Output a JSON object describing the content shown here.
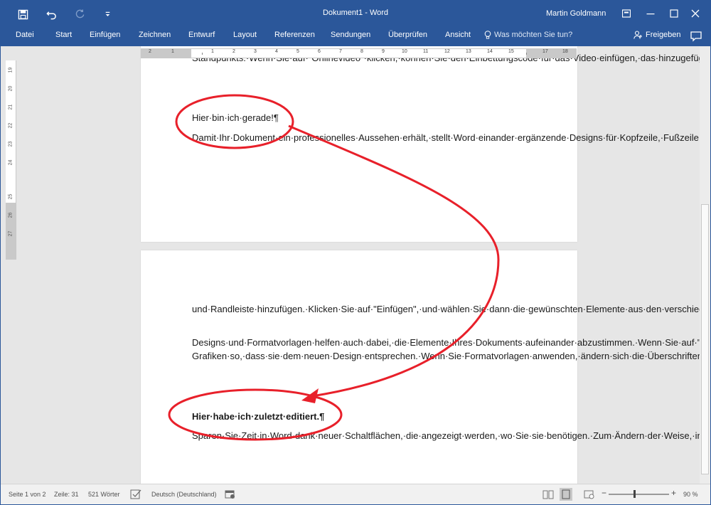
{
  "titlebar": {
    "doc_title": "Dokument1  -  Word",
    "user_name": "Martin Goldmann"
  },
  "ribbon": {
    "tabs": [
      "Datei",
      "Start",
      "Einfügen",
      "Zeichnen",
      "Entwurf",
      "Layout",
      "Referenzen",
      "Sendungen",
      "Überprüfen",
      "Ansicht"
    ],
    "tell_me": "Was möchten Sie tun?",
    "share": "Freigeben"
  },
  "ruler": {
    "horizontal_ticks": [
      "2",
      "1",
      "1",
      "2",
      "3",
      "4",
      "5",
      "6",
      "7",
      "8",
      "9",
      "10",
      "11",
      "12",
      "13",
      "14",
      "15",
      "17",
      "18"
    ],
    "vertical_ticks": [
      "19",
      "20",
      "21",
      "22",
      "23",
      "24",
      "25",
      "26",
      "27"
    ]
  },
  "page1": {
    "p1": "Standpunkts.·Wenn·Sie·auf·\"Onlinevideo\"·klicken,·können·Sie·den·Einbettungscode·für·das·Video·einfügen,·das·hinzugefügt·werden·soll.·Sie·können·auch·ein·Stichwort·eingeben,·um·online·nach·dem·Videoclip·zu·suchen,·der·optimal·zu·Ihrem·Dokument·passt.¶",
    "p2": "Hier·bin·ich·gerade!¶",
    "p3": "Damit·Ihr·Dokument·ein·professionelles·Aussehen·erhält,·stellt·Word·einander·ergänzende·Designs·für·Kopfzeile,·Fußzeile,·Deckblatt·und·Textfelder·zur·Verfügung.·Beispielsweise·können·Sie·ein·passendes·Deckblatt·mit·Kopfzeile·"
  },
  "page2": {
    "p1": "und·Randleiste·hinzufügen.·Klicken·Sie·auf·\"Einfügen\",·und·wählen·Sie·dann·die·gewünschten·Elemente·aus·den·verschiedenen·Katalogen·aus.¶",
    "p2": "Designs·und·Formatvorlagen·helfen·auch·dabei,·die·Elemente·Ihres·Dokuments·aufeinander·abzustimmen.·Wenn·Sie·auf·\"Design\"·klicken·und·ein·neues·Design·auswählen,·ändern·sich·die·Grafiken,·Diagramme·und·SmartArt-Grafiken·so,·dass·sie·dem·neuen·Design·entsprechen.·Wenn·Sie·Formatvorlagen·anwenden,·ändern·sich·die·Überschriften·passend·zum·neuen·Design.¶",
    "p3": "Hier·habe·ich·zuletzt·editiert.¶",
    "p4": "Sparen·Sie·Zeit·in·Word·dank·neuer·Schaltflächen,·die·angezeigt·werden,·wo·Sie·sie·benötigen.·Zum·Ändern·der·Weise,·in·der·sich·ein·Bild·in·Ihr·Dokument·einfügt,·klicken·Sie·auf·das·Bild.·Dann·wird·eine·Schaltfläche·für·Layoutoptionen·neben·dem·Bild·angezeigt·Beim·Arbeiten·an·einer·Tabelle·klicken·Sie·an·die·"
  },
  "statusbar": {
    "page": "Seite 1 von 2",
    "line": "Zeile: 31",
    "words": "521 Wörter",
    "language": "Deutsch (Deutschland)",
    "zoom_minus": "−",
    "zoom_plus": "+",
    "zoom": "90 %"
  },
  "colors": {
    "accent": "#2b579a",
    "annotation": "#e8202a"
  },
  "icons": [
    "save-icon",
    "undo-icon",
    "redo-icon",
    "customize-icon",
    "ribbon-display-icon",
    "minimize-icon",
    "maximize-icon",
    "close-icon",
    "lightbulb-icon",
    "person-icon",
    "comment-icon",
    "proofing-icon",
    "macro-icon",
    "read-mode-icon",
    "print-layout-icon",
    "web-layout-icon"
  ]
}
